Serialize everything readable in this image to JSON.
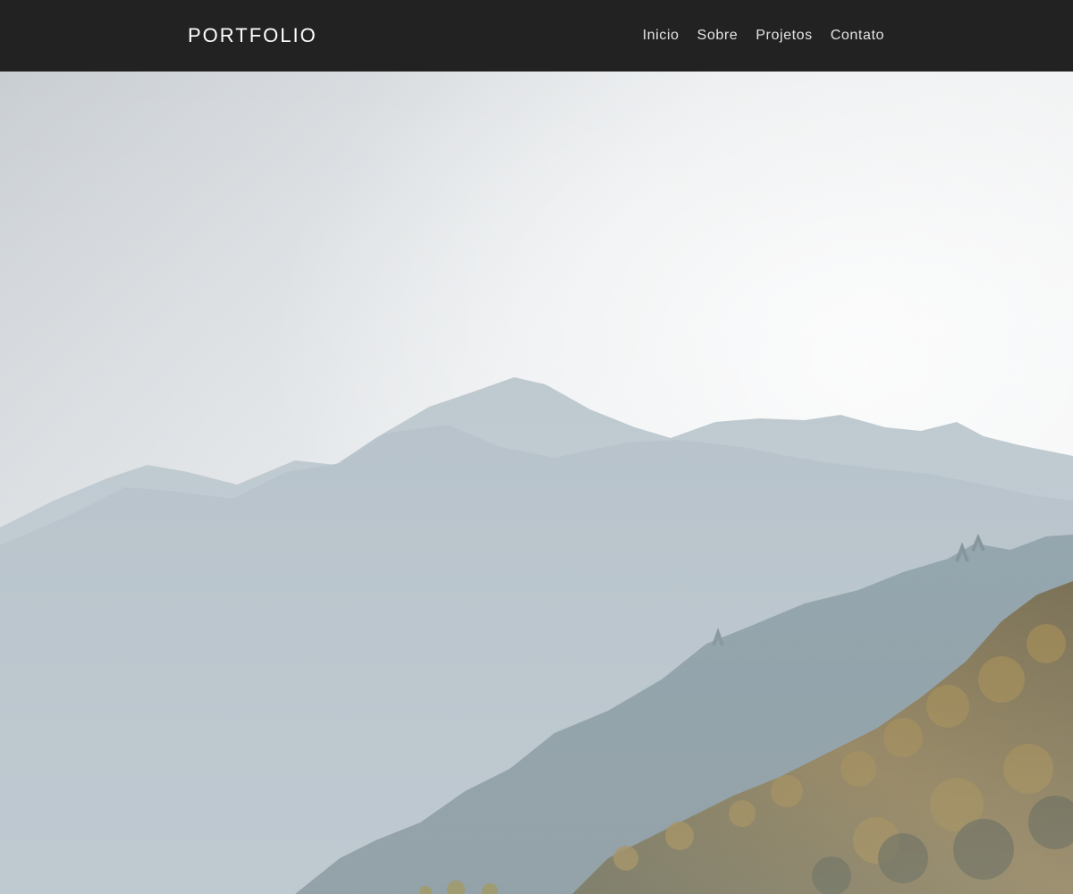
{
  "navbar": {
    "brand": "PORTFOLIO",
    "links": [
      "Inicio",
      "Sobre",
      "Projetos",
      "Contato"
    ],
    "background": "#222222",
    "text_color": "#ffffff"
  },
  "hero": {
    "image": "misty-mountain-landscape"
  }
}
